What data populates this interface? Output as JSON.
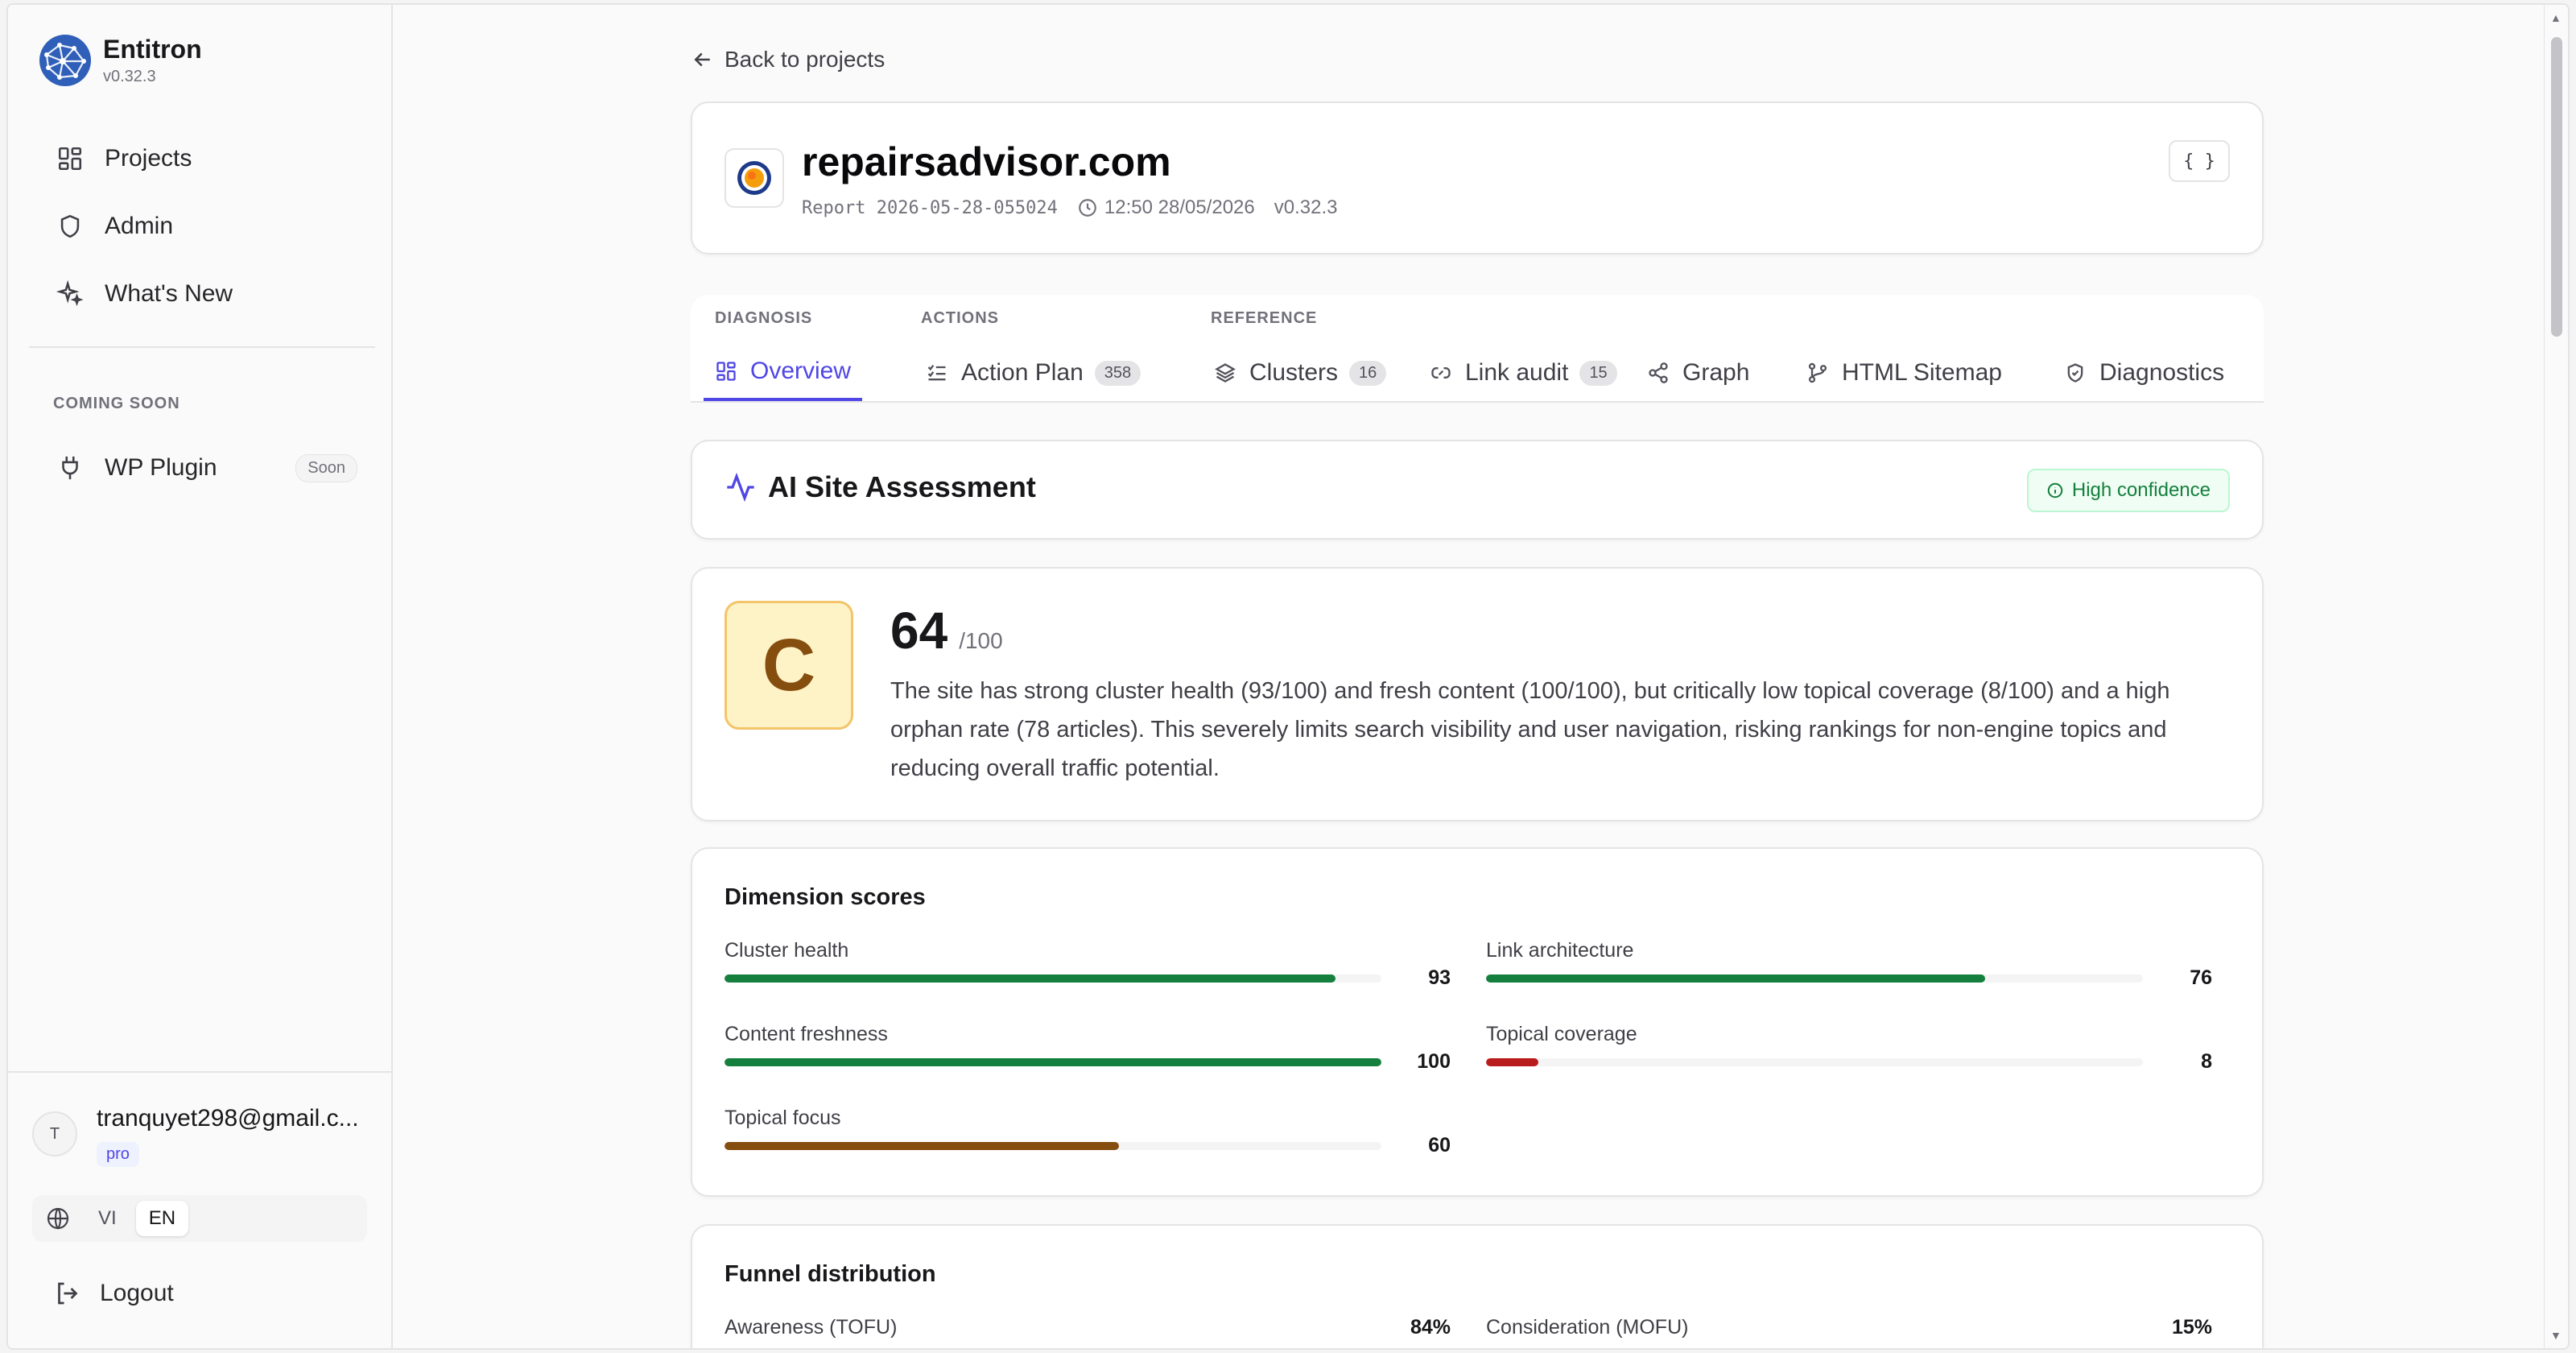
{
  "brand": {
    "name": "Entitron",
    "version": "v0.32.3"
  },
  "sidebar": {
    "nav": [
      {
        "label": "Projects",
        "icon": "grid-icon"
      },
      {
        "label": "Admin",
        "icon": "shield-icon"
      },
      {
        "label": "What's New",
        "icon": "sparkles-icon"
      }
    ],
    "coming_soon_label": "COMING SOON",
    "plugin": {
      "label": "WP Plugin",
      "badge": "Soon",
      "icon": "plug-icon"
    },
    "user": {
      "avatar_initial": "T",
      "email": "tranquyet298@gmail.c...",
      "plan": "pro"
    },
    "languages": [
      {
        "code": "VI",
        "active": false
      },
      {
        "code": "EN",
        "active": true
      }
    ],
    "logout_label": "Logout"
  },
  "main": {
    "back_label": "Back to projects",
    "project": {
      "title": "repairsadvisor.com",
      "report_id": "Report 2026-05-28-055024",
      "time": "12:50 28/05/2026",
      "version": "v0.32.3",
      "json_button": "{ }"
    },
    "tab_groups": [
      {
        "label": "DIAGNOSIS"
      },
      {
        "label": "ACTIONS"
      },
      {
        "label": "REFERENCE"
      }
    ],
    "tabs": [
      {
        "label": "Overview",
        "icon": "layout-grid-icon",
        "active": true
      },
      {
        "label": "Action Plan",
        "icon": "list-checks-icon",
        "count": "358"
      },
      {
        "label": "Clusters",
        "icon": "layers-icon",
        "count": "16"
      },
      {
        "label": "Link audit",
        "icon": "link-icon",
        "count": "15"
      },
      {
        "label": "Graph",
        "icon": "share-icon"
      },
      {
        "label": "HTML Sitemap",
        "icon": "git-branch-icon"
      },
      {
        "label": "Diagnostics",
        "icon": "shield-check-icon"
      }
    ],
    "assessment": {
      "title": "AI Site Assessment",
      "confidence": "High confidence",
      "grade": "C",
      "score": "64",
      "score_max": "/100",
      "summary": "The site has strong cluster health (93/100) and fresh content (100/100), but critically low topical coverage (8/100) and a high orphan rate (78 articles). This severely limits search visibility and user navigation, risking rankings for non-engine topics and reducing overall traffic potential."
    },
    "dimensions": {
      "title": "Dimension scores",
      "items": [
        {
          "label": "Cluster health",
          "value": 93,
          "color": "#15803d"
        },
        {
          "label": "Link architecture",
          "value": 76,
          "color": "#15803d"
        },
        {
          "label": "Content freshness",
          "value": 100,
          "color": "#15803d"
        },
        {
          "label": "Topical coverage",
          "value": 8,
          "color": "#b91c1c"
        },
        {
          "label": "Topical focus",
          "value": 60,
          "color": "#854d0e"
        }
      ]
    },
    "funnel": {
      "title": "Funnel distribution",
      "items": [
        {
          "label": "Awareness (TOFU)",
          "percent": "84%",
          "value": 84,
          "color": "#4f46e5"
        },
        {
          "label": "Consideration (MOFU)",
          "percent": "15%",
          "value": 15,
          "color": "#2563eb"
        }
      ]
    }
  }
}
